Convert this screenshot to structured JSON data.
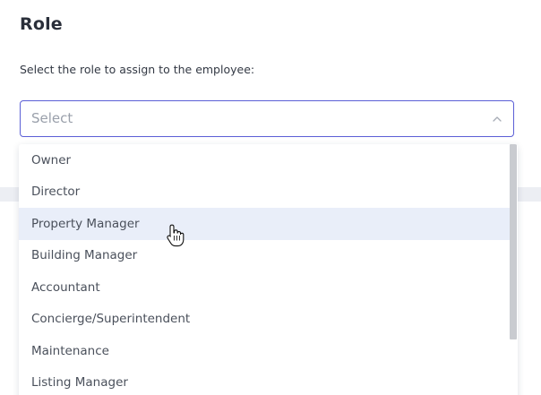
{
  "section": {
    "title": "Role",
    "instruction": "Select the role to assign to the employee:"
  },
  "select": {
    "placeholder": "Select",
    "icon": "chevron-up-icon",
    "focus_color": "#5b5fd6"
  },
  "dropdown": {
    "hover_color": "#e9eef9",
    "hovered_index": 2,
    "options": [
      {
        "label": "Owner"
      },
      {
        "label": "Director"
      },
      {
        "label": "Property Manager"
      },
      {
        "label": "Building Manager"
      },
      {
        "label": "Accountant"
      },
      {
        "label": "Concierge/Superintendent"
      },
      {
        "label": "Maintenance"
      },
      {
        "label": "Listing Manager"
      }
    ]
  },
  "cursor": {
    "icon": "hand-pointer-icon"
  }
}
